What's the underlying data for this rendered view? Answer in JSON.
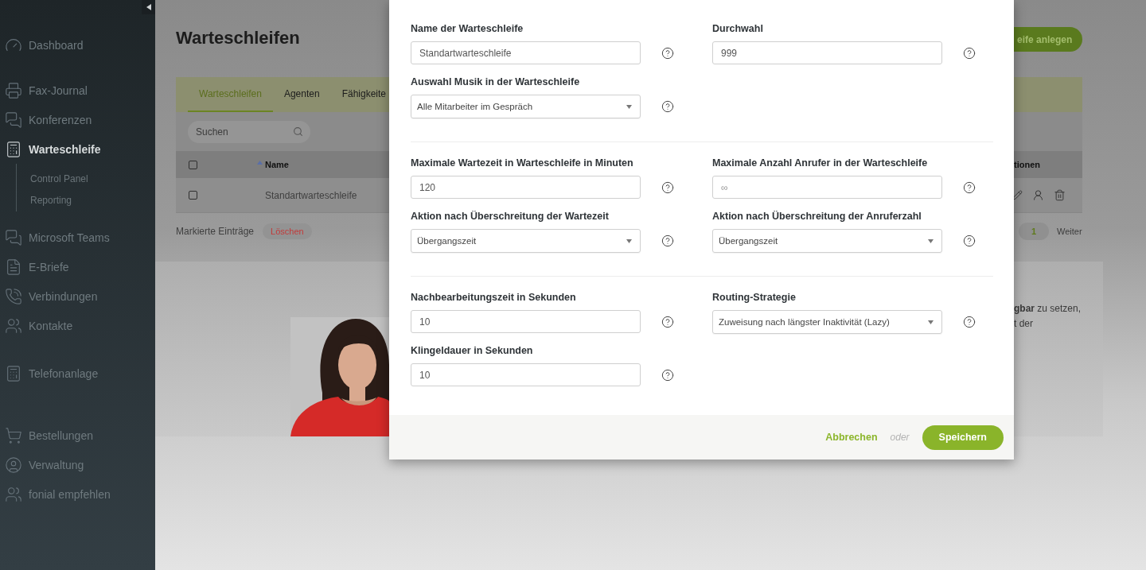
{
  "sidebar": {
    "groups": [
      [
        {
          "label": "Dashboard",
          "selected": false
        }
      ],
      [
        {
          "label": "Fax-Journal",
          "selected": false
        },
        {
          "label": "Konferenzen",
          "selected": false
        },
        {
          "label": "Warteschleife",
          "selected": true,
          "children": [
            {
              "label": "Control Panel",
              "selected": false
            },
            {
              "label": "Reporting",
              "selected": false
            }
          ]
        },
        {
          "label": "Microsoft Teams",
          "selected": false
        },
        {
          "label": "E-Briefe",
          "selected": false
        },
        {
          "label": "Verbindungen",
          "selected": false
        },
        {
          "label": "Kontakte",
          "selected": false
        }
      ],
      [
        {
          "label": "Telefonanlage",
          "selected": false
        }
      ],
      [
        {
          "label": "Bestellungen",
          "selected": false
        },
        {
          "label": "Verwaltung",
          "selected": false
        },
        {
          "label": "fonial empfehlen",
          "selected": false
        }
      ]
    ]
  },
  "page": {
    "title": "Warteschleifen",
    "create_button": "eife anlegen",
    "tabs": [
      {
        "label": "Warteschleifen",
        "selected": true
      },
      {
        "label": "Agenten",
        "selected": false
      },
      {
        "label": "Fähigkeite",
        "selected": false
      }
    ],
    "search": {
      "placeholder": "Suchen"
    },
    "table": {
      "header_checked": false,
      "columns": [
        {
          "label": "Name",
          "sorted": true
        },
        {
          "label": "tionen",
          "sorted": false
        }
      ],
      "rows": [
        {
          "checked": false,
          "name": "Standartwarteschleife"
        }
      ]
    },
    "bulk": {
      "label": "Markierte Einträge",
      "button": "Löschen"
    },
    "pagination": {
      "pages": [
        {
          "label": "1",
          "selected": true
        }
      ],
      "next": "Weiter"
    },
    "banner": {
      "picture": {
        "kind": "picture"
      },
      "lines": [
        "**gbar** zu setzen,",
        "t der"
      ]
    }
  },
  "modal": {
    "sections": [
      {
        "left": [
          {
            "kind": "input",
            "label": "Name der Warteschleife",
            "value": "Standartwarteschleife"
          },
          {
            "kind": "select",
            "label": "Auswahl Musik in der Warteschleife",
            "value": "Alle Mitarbeiter im Gespräch"
          }
        ],
        "right": [
          {
            "kind": "input",
            "label": "Durchwahl",
            "value": "999"
          }
        ]
      },
      {
        "left": [
          {
            "kind": "input",
            "label": "Maximale Wartezeit in Warteschleife in Minuten",
            "value": "120"
          },
          {
            "kind": "select",
            "label": "Aktion nach Überschreitung der Wartezeit",
            "value": "Übergangszeit"
          }
        ],
        "right": [
          {
            "kind": "input",
            "label": "Maximale Anzahl Anrufer in der Warteschleife",
            "placeholder": "∞"
          },
          {
            "kind": "select",
            "label": "Aktion nach Überschreitung der Anruferzahl",
            "value": "Übergangszeit"
          }
        ]
      },
      {
        "left": [
          {
            "kind": "input",
            "label": "Nachbearbeitungszeit in Sekunden",
            "value": "10"
          },
          {
            "kind": "input",
            "label": "Klingeldauer in Sekunden",
            "value": "10"
          }
        ],
        "right": [
          {
            "kind": "select",
            "label": "Routing-Strategie",
            "value": "Zuweisung nach längster Inaktivität (Lazy)"
          }
        ]
      }
    ],
    "footer": {
      "cancel": "Abbrechen",
      "separator": "oder",
      "save": "Speichern"
    }
  }
}
